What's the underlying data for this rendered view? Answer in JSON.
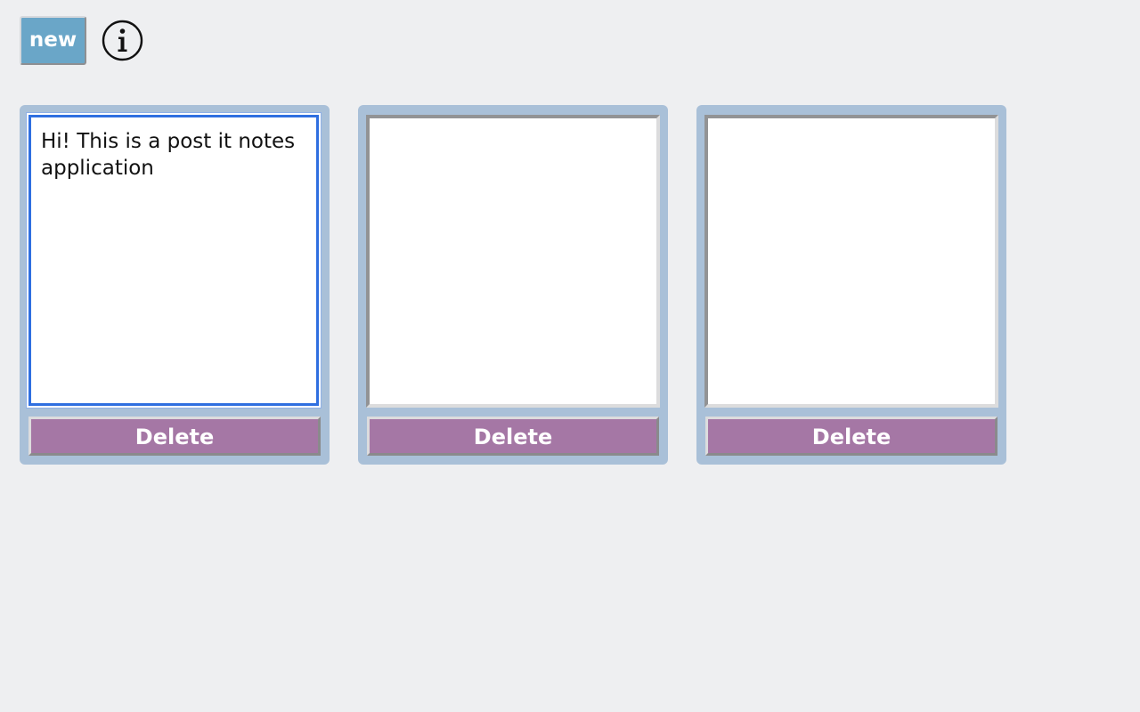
{
  "toolbar": {
    "new_label": "new",
    "info_icon": "info-icon"
  },
  "colors": {
    "background": "#eeeff1",
    "new_button": "#6aa6c8",
    "note_frame": "#a9c0d8",
    "delete_button": "#a577a5",
    "focus_ring": "#2f6fe0"
  },
  "notes": [
    {
      "text": "Hi! This is a post it notes application",
      "delete_label": "Delete",
      "focused": true
    },
    {
      "text": "",
      "delete_label": "Delete",
      "focused": false
    },
    {
      "text": "",
      "delete_label": "Delete",
      "focused": false
    }
  ]
}
